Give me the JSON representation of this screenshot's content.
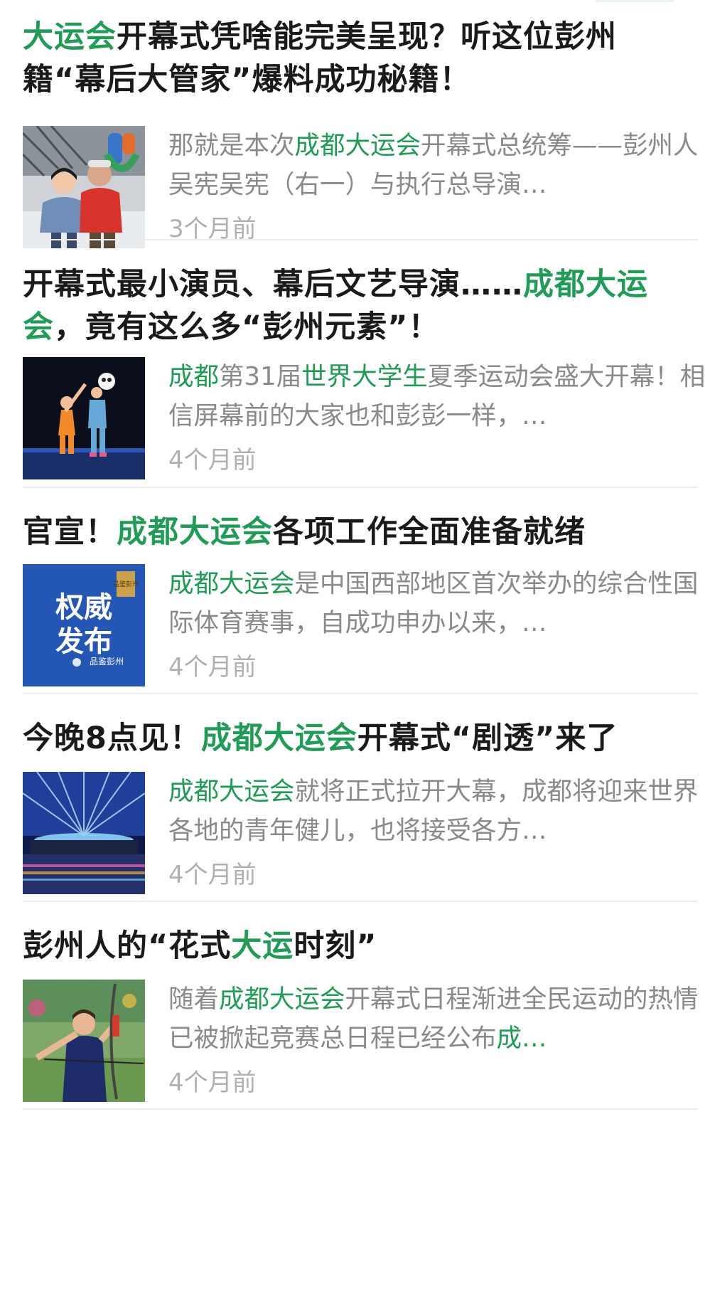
{
  "articles": [
    {
      "title": [
        {
          "text": "大运会",
          "hl": true
        },
        {
          "text": "开幕式凭啥能完美呈现？听这位彭州籍“幕后大管家”爆料成功秘籍！",
          "hl": false
        }
      ],
      "excerpt": [
        {
          "text": "那就是本次",
          "hl": false
        },
        {
          "text": "成都大运会",
          "hl": true
        },
        {
          "text": "开幕式总统筹——彭州人吴宪吴宪（右一）与执行总导演…",
          "hl": false
        }
      ],
      "time": "3个月前",
      "thumb": "two-people-photo"
    },
    {
      "title": [
        {
          "text": "开幕式最小演员、幕后文艺导演……",
          "hl": false
        },
        {
          "text": "成都大运会",
          "hl": true
        },
        {
          "text": "，竟有这么多“彭州元素”！",
          "hl": false
        }
      ],
      "excerpt": [
        {
          "text": "成都",
          "hl": true
        },
        {
          "text": "第31届",
          "hl": false
        },
        {
          "text": "世界大学生",
          "hl": true
        },
        {
          "text": "夏季运动会盛大开幕！相信屏幕前的大家也和彭彭一样，…",
          "hl": false
        }
      ],
      "time": "4个月前",
      "thumb": "stage-performers-photo"
    },
    {
      "title": [
        {
          "text": "官宣！",
          "hl": false
        },
        {
          "text": "成都大运会",
          "hl": true
        },
        {
          "text": "各项工作全面准备就绪",
          "hl": false
        }
      ],
      "excerpt": [
        {
          "text": "成都大运会",
          "hl": true
        },
        {
          "text": "是中国西部地区首次举办的综合性国际体育赛事，自成功申办以来，…",
          "hl": false
        }
      ],
      "time": "4个月前",
      "thumb": "authority-release-graphic",
      "thumb_text": {
        "line1": "权威",
        "line2": "发布",
        "badge": "品鉴彭州",
        "seal": "品鉴彭州"
      }
    },
    {
      "title": [
        {
          "text": "今晚8点见！",
          "hl": false
        },
        {
          "text": "成都大运会",
          "hl": true
        },
        {
          "text": "开幕式“剧透”来了",
          "hl": false
        }
      ],
      "excerpt": [
        {
          "text": "成都大运会",
          "hl": true
        },
        {
          "text": "就将正式拉开大幕，成都将迎来世界各地的青年健儿，也将接受各方…",
          "hl": false
        }
      ],
      "time": "4个月前",
      "thumb": "stadium-night-photo"
    },
    {
      "title": [
        {
          "text": "彭州人的“花式",
          "hl": false
        },
        {
          "text": "大运",
          "hl": true
        },
        {
          "text": "时刻”",
          "hl": false
        }
      ],
      "excerpt": [
        {
          "text": "随着",
          "hl": false
        },
        {
          "text": "成都大运会",
          "hl": true
        },
        {
          "text": "开幕式日程渐进全民运动的热情已被掀起竞赛总日程已经公布",
          "hl": false
        },
        {
          "text": "成…",
          "hl": true
        }
      ],
      "time": "4个月前",
      "thumb": "archer-photo"
    }
  ],
  "colors": {
    "highlight": "#1f9c55",
    "title": "#1a1a1a",
    "excerpt": "#8a8a8a",
    "time": "#b0b0b0",
    "divider": "#ececec"
  }
}
